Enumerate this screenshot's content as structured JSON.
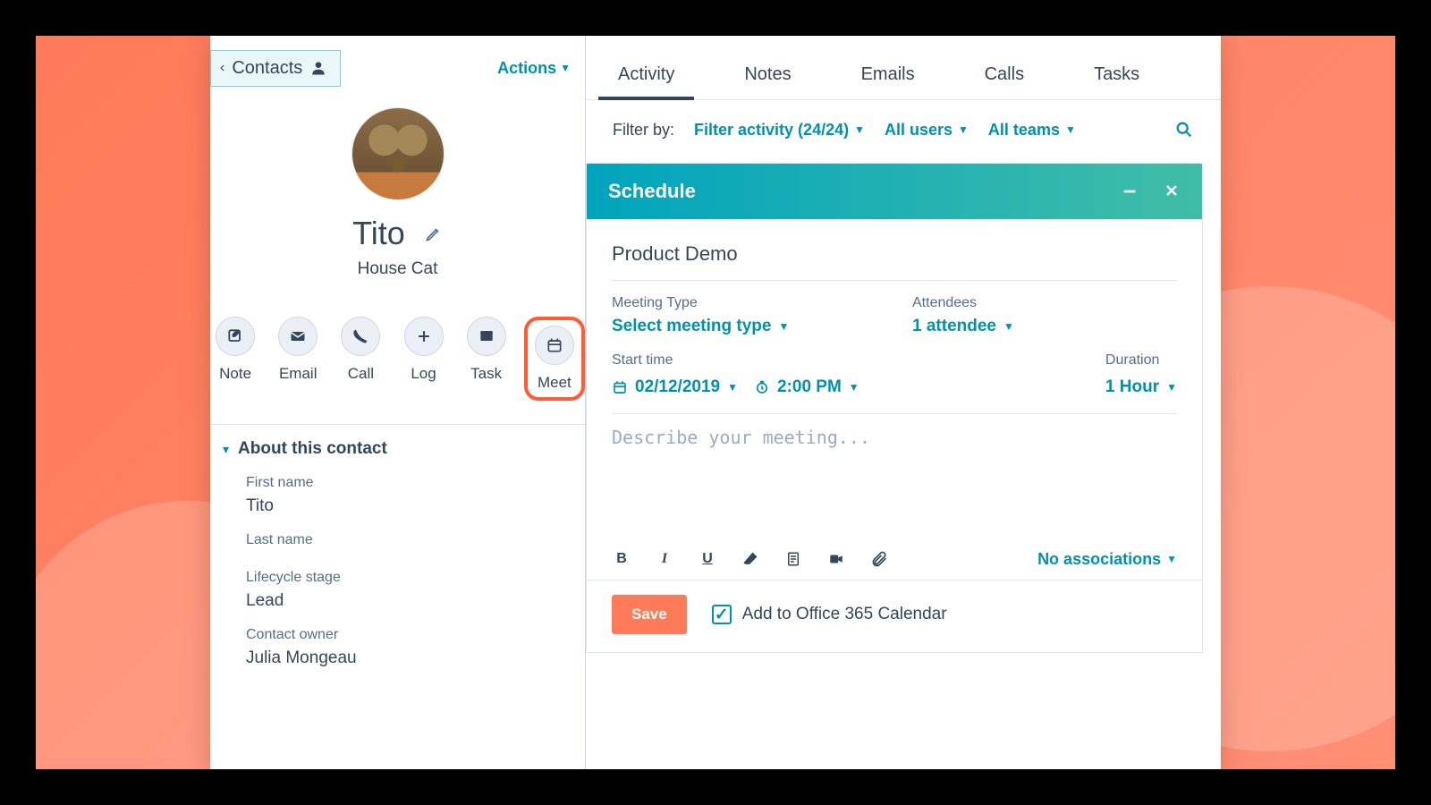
{
  "header": {
    "back_label": "Contacts",
    "actions_label": "Actions"
  },
  "contact": {
    "name": "Tito",
    "subtitle": "House Cat"
  },
  "quick_actions": [
    {
      "key": "note",
      "label": "Note",
      "icon": "compose-icon"
    },
    {
      "key": "email",
      "label": "Email",
      "icon": "envelope-icon"
    },
    {
      "key": "call",
      "label": "Call",
      "icon": "phone-icon"
    },
    {
      "key": "log",
      "label": "Log",
      "icon": "plus-icon"
    },
    {
      "key": "task",
      "label": "Task",
      "icon": "window-icon"
    },
    {
      "key": "meet",
      "label": "Meet",
      "icon": "calendar-icon"
    }
  ],
  "about": {
    "heading": "About this contact",
    "fields": {
      "first_name": {
        "label": "First name",
        "value": "Tito"
      },
      "last_name": {
        "label": "Last name",
        "value": ""
      },
      "lifecycle": {
        "label": "Lifecycle stage",
        "value": "Lead"
      },
      "owner": {
        "label": "Contact owner",
        "value": "Julia Mongeau"
      }
    }
  },
  "tabs": [
    "Activity",
    "Notes",
    "Emails",
    "Calls",
    "Tasks"
  ],
  "active_tab": "Activity",
  "filters": {
    "label": "Filter by:",
    "activity": "Filter activity (24/24)",
    "users": "All users",
    "teams": "All teams"
  },
  "schedule": {
    "panel_title": "Schedule",
    "title_value": "Product Demo",
    "meeting_type": {
      "label": "Meeting Type",
      "value": "Select meeting type"
    },
    "attendees": {
      "label": "Attendees",
      "value": "1 attendee"
    },
    "start_time": {
      "label": "Start time",
      "date": "02/12/2019",
      "time": "2:00 PM"
    },
    "duration": {
      "label": "Duration",
      "value": "1 Hour"
    },
    "description_placeholder": "Describe your meeting...",
    "associations_label": "No associations",
    "save_label": "Save",
    "calendar_checkbox_label": "Add to Office 365 Calendar",
    "calendar_checked": true
  }
}
